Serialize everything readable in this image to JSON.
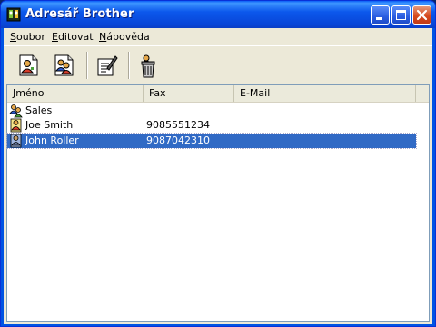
{
  "window": {
    "title": "Adresář Brother",
    "controls": [
      "minimize-icon",
      "maximize-icon",
      "close-icon"
    ]
  },
  "menu": {
    "items": [
      {
        "label": "Soubor"
      },
      {
        "label": "Editovat"
      },
      {
        "label": "Nápověda"
      }
    ]
  },
  "toolbar": {
    "buttons": [
      {
        "icon": "new-contact-icon"
      },
      {
        "icon": "new-group-icon"
      },
      {
        "icon": "edit-icon"
      },
      {
        "icon": "delete-icon"
      }
    ]
  },
  "list": {
    "columns": [
      "Jméno",
      "Fax",
      "E-Mail"
    ],
    "rows": [
      {
        "name": "Sales",
        "fax": "",
        "email": "",
        "icon": "group-icon",
        "selected": false
      },
      {
        "name": "Joe Smith",
        "fax": "9085551234",
        "email": "",
        "icon": "contact-icon",
        "selected": false
      },
      {
        "name": "John Roller",
        "fax": "9087042310",
        "email": "",
        "icon": "contact-icon",
        "selected": true
      }
    ]
  },
  "colors": {
    "titlebar": "#0058e6",
    "selection": "#316ac5",
    "face": "#ece9d8"
  }
}
